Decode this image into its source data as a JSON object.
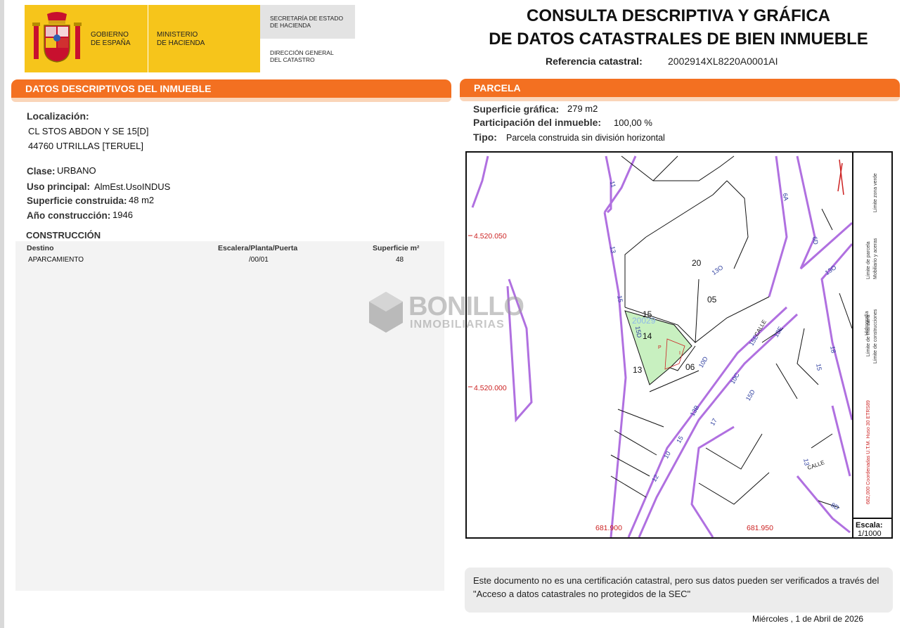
{
  "header": {
    "gov_label": "GOBIERNO\nDE ESPAÑA",
    "ministry_label": "MINISTERIO\nDE HACIENDA",
    "secretary_label": "SECRETARÍA DE ESTADO\nDE HACIENDA",
    "direction_label": "DIRECCIÓN GENERAL\nDEL CATASTRO",
    "title_line1": "CONSULTA DESCRIPTIVA Y GRÁFICA",
    "title_line2": "DE DATOS CATASTRALES DE BIEN INMUEBLE",
    "ref_label": "Referencia catastral:",
    "ref_value": "2002914XL8220A0001AI"
  },
  "left": {
    "tab": "DATOS DESCRIPTIVOS DEL INMUEBLE",
    "localizacion_label": "Localización:",
    "address_line1": "CL STOS ABDON Y SE 15[D]",
    "address_line2": "44760 UTRILLAS [TERUEL]",
    "clase_label": "Clase:",
    "clase_value": "URBANO",
    "uso_label": "Uso principal:",
    "uso_value": "AlmEst.UsoINDUS",
    "sup_label": "Superficie construida:",
    "sup_value": "48 m2",
    "anio_label": "Año construcción:",
    "anio_value": "1946",
    "construccion_heading": "CONSTRUCCIÓN",
    "table": {
      "headers": [
        "Destino",
        "Escalera/Planta/Puerta",
        "Superficie m²"
      ],
      "rows": [
        [
          "APARCAMIENTO",
          "/00/01",
          "48"
        ]
      ]
    }
  },
  "right": {
    "tab": "PARCELA",
    "sup_grafica_label": "Superficie gráfica:",
    "sup_grafica_value": "279 m2",
    "participacion_label": "Participación del inmueble:",
    "participacion_value": "100,00 %",
    "tipo_label": "Tipo:",
    "tipo_value": "Parcela construida sin división horizontal"
  },
  "map": {
    "coord_y_top": "4.520.050",
    "coord_y_bottom": "4.520.000",
    "coord_x_left": "681.900",
    "coord_x_right": "681.950",
    "parcel_label": "20029",
    "numbers": [
      "20",
      "05",
      "15",
      "14",
      "13",
      "06",
      "11",
      "13",
      "15",
      "15D",
      "13O",
      "13O",
      "6A",
      "6D",
      "13E",
      "15D",
      "10C",
      "10D",
      "13B",
      "15",
      "14",
      "12",
      "10",
      "17",
      "18",
      "15",
      "15E",
      "13",
      "8D",
      "CALLE",
      "CALLE",
      "15",
      "P",
      "I"
    ],
    "scale_label": "Escala:",
    "scale_value": "1/1000",
    "legend": [
      "Límite de manzana",
      "Límite de parcela",
      "Hidrografía",
      "Límite de construcciones",
      "Mobiliario y aceras",
      "Límite zona verde",
      "682,000 Coordenadas U.T.M. Huso 30 ETRS89"
    ],
    "colors": {
      "manzana": "#b070e0",
      "parcela": "#111111",
      "parcel_fill": "#c8f0c0",
      "coord_text": "#cc2222",
      "hidrografia": "#5577dd"
    }
  },
  "note": "Este documento no es una certificación catastral, pero sus datos pueden ser verificados a través del \"Acceso a datos catastrales no protegidos de la SEC\"",
  "date": "Miércoles , 1 de Abril de 2026",
  "watermark": {
    "line1": "BONILLO",
    "line2": "INMOBILIARIAS"
  }
}
